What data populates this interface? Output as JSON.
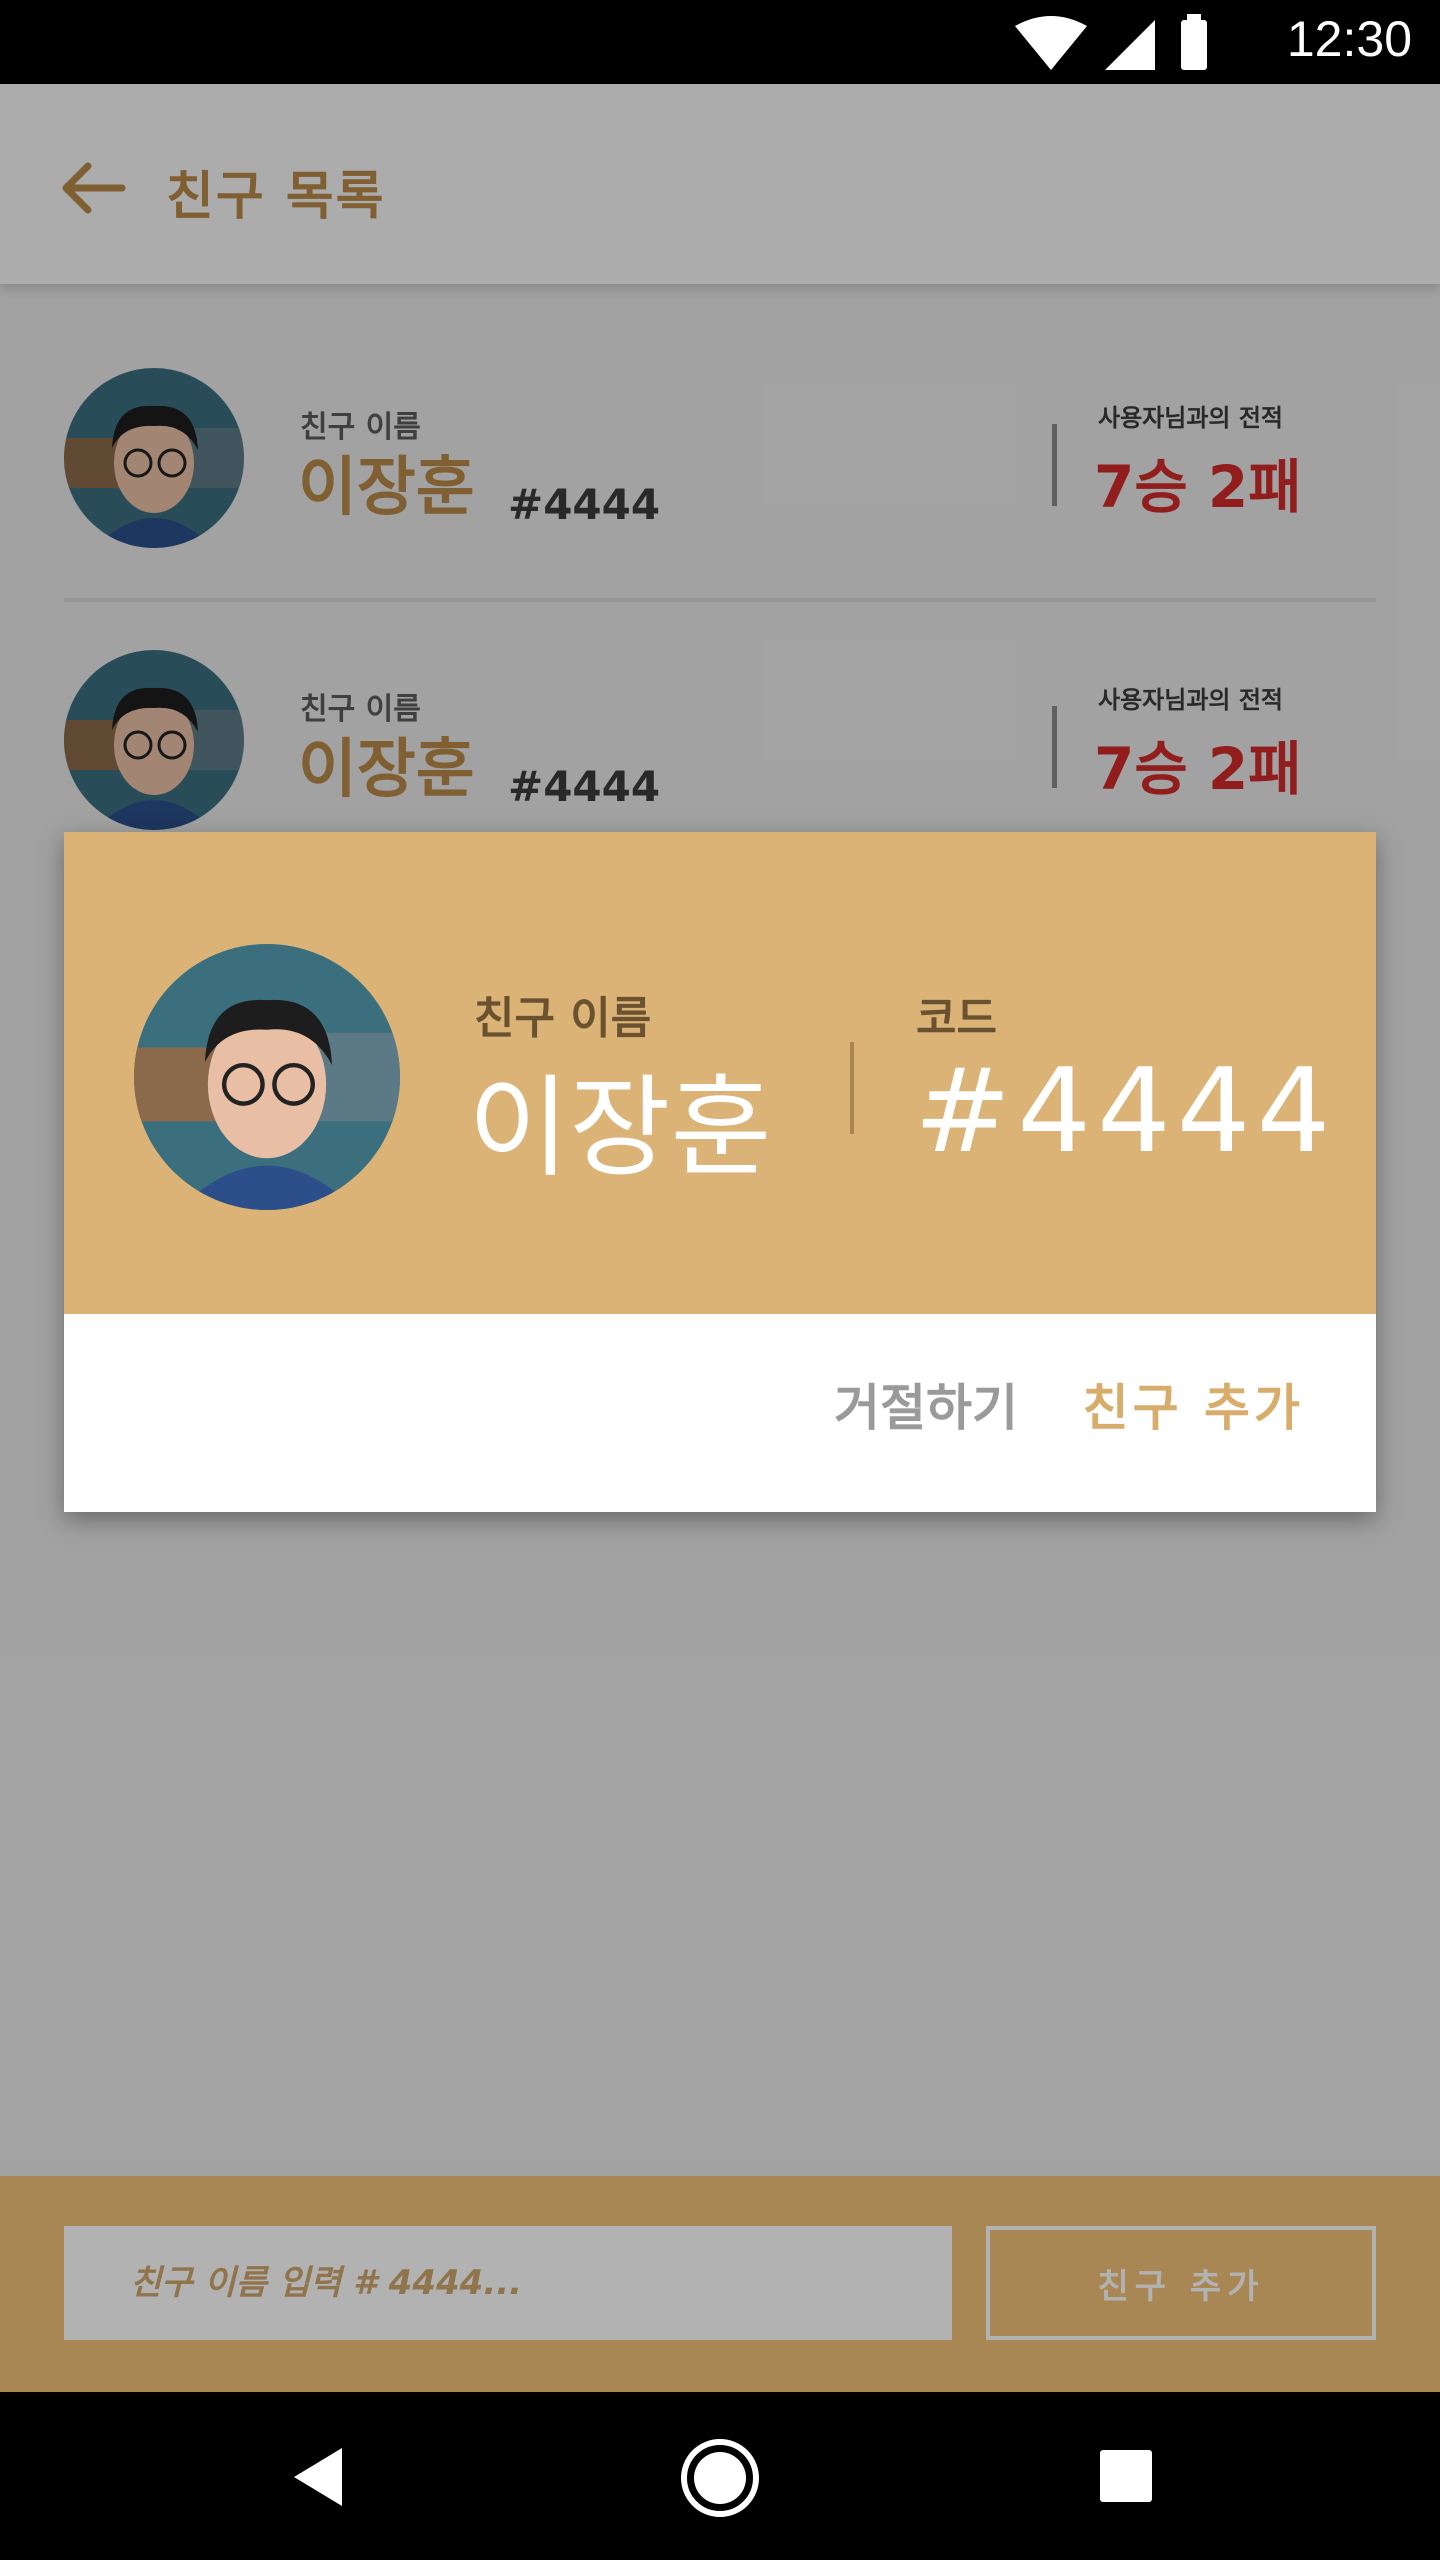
{
  "status_bar": {
    "time": "12:30",
    "icons": [
      "wifi-icon",
      "signal-icon",
      "battery-icon"
    ]
  },
  "app_bar": {
    "title": "친구 목록",
    "back_icon": "arrow-left-icon"
  },
  "friends": [
    {
      "label": "친구 이름",
      "name": "이장훈",
      "code": "#4444",
      "record_label": "사용자님과의 전적",
      "record": "7승 2패"
    },
    {
      "label": "친구 이름",
      "name": "이장훈",
      "code": "#4444",
      "record_label": "사용자님과의 전적",
      "record": "7승 2패"
    }
  ],
  "dialog": {
    "name_label": "친구 이름",
    "name": "이장훈",
    "code_label": "코드",
    "code": "#4444",
    "reject_label": "거절하기",
    "accept_label": "친구 추가"
  },
  "bottom_bar": {
    "input_placeholder": "친구 이름 입력 # 4444...",
    "add_button_label": "친구 추가"
  },
  "nav_bar": {
    "icons": [
      "back-triangle-icon",
      "home-circle-icon",
      "recents-square-icon"
    ]
  },
  "colors": {
    "accent": "#b88a48",
    "header_gold": "#dbb377",
    "record_red": "#d02a2a",
    "bottom_bar": "#f2c27a"
  }
}
